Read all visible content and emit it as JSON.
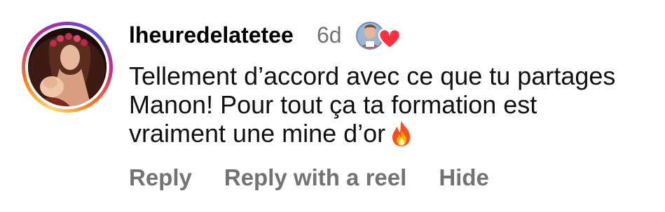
{
  "comment": {
    "username": "lheuredelatetee",
    "time_ago": "6d",
    "text_before_emoji": "Tellement d’accord avec ce que tu partages Manon! Pour tout ça ta formation est vraiment une mine d’or",
    "emoji_icon": "fire-icon",
    "liked_by_creator_icon": "creator-avatar-heart-icon",
    "actions": {
      "reply": "Reply",
      "reply_with_reel": "Reply with a reel",
      "hide": "Hide"
    }
  },
  "colors": {
    "secondary_text": "#737373",
    "heart": "#ff3040",
    "story_ring": [
      "#feda75",
      "#fa7e1e",
      "#d62976",
      "#962fbf",
      "#4f5bd5"
    ]
  }
}
